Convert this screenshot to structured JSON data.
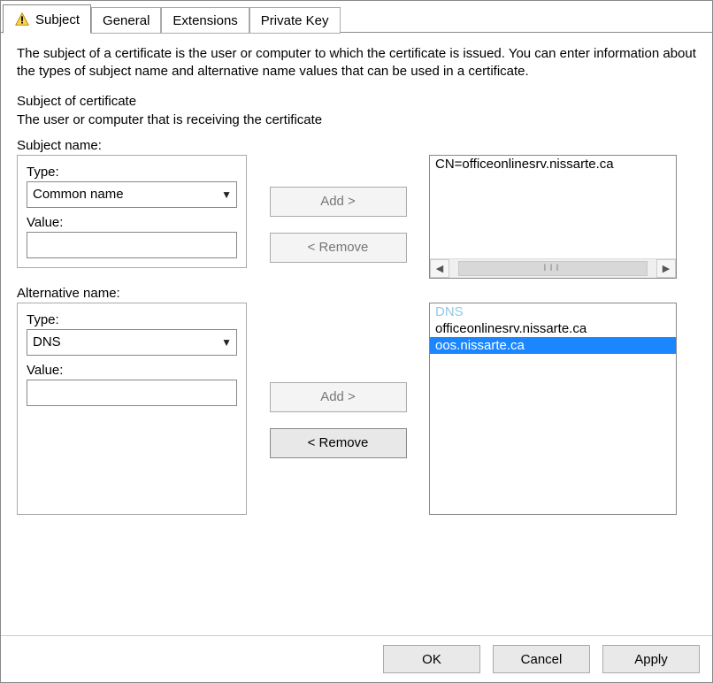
{
  "tabs": {
    "subject": "Subject",
    "general": "General",
    "extensions": "Extensions",
    "private_key": "Private Key"
  },
  "description": "The subject of a certificate is the user or computer to which the certificate is issued. You can enter information about the types of subject name and alternative name values that can be used in a certificate.",
  "subject_of_certificate_heading": "Subject of certificate",
  "subject_of_certificate_sub": "The user or computer that is receiving the certificate",
  "subject_name": {
    "label": "Subject name:",
    "type_label": "Type:",
    "type_value": "Common name",
    "value_label": "Value:",
    "value_text": "",
    "add_label": "Add >",
    "remove_label": "< Remove",
    "list": [
      "CN=officeonlinesrv.nissarte.ca"
    ]
  },
  "alternative_name": {
    "label": "Alternative name:",
    "type_label": "Type:",
    "type_value": "DNS",
    "value_label": "Value:",
    "value_text": "",
    "add_label": "Add >",
    "remove_label": "< Remove",
    "list_header": "DNS",
    "list": [
      "officeonlinesrv.nissarte.ca",
      "oos.nissarte.ca"
    ],
    "selected_index": 1
  },
  "footer": {
    "ok": "OK",
    "cancel": "Cancel",
    "apply": "Apply"
  }
}
